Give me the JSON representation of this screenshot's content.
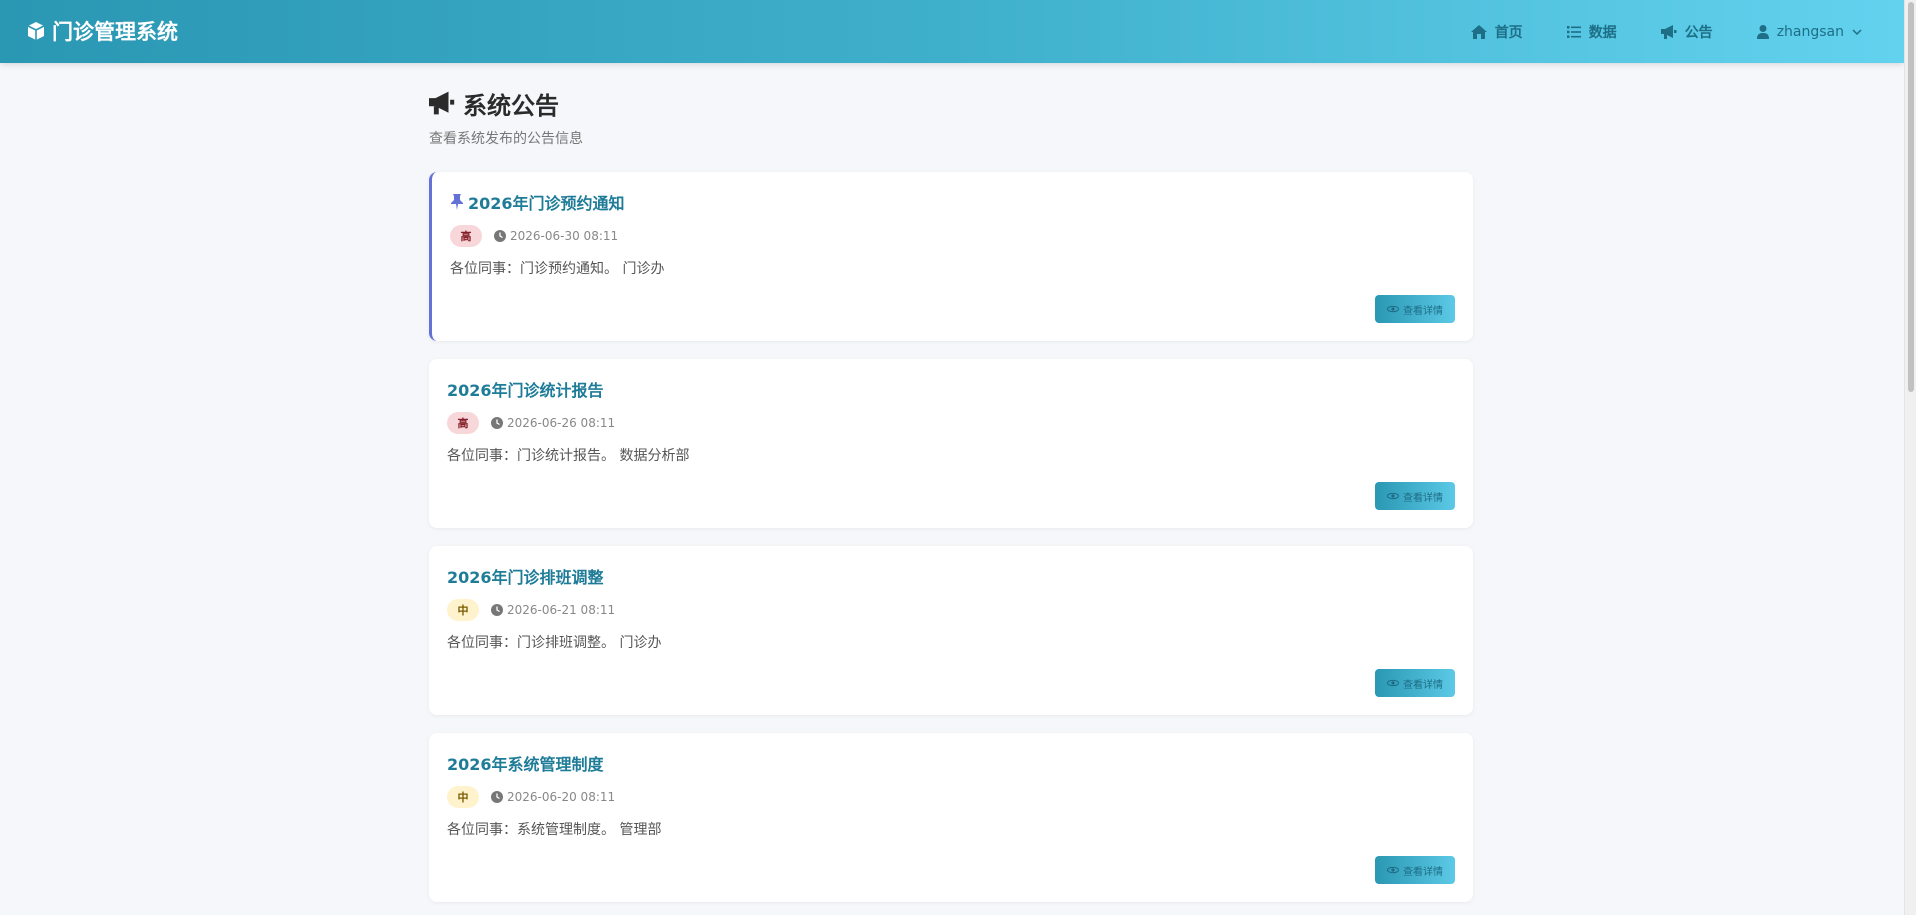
{
  "app": {
    "title": "门诊管理系统"
  },
  "nav": {
    "items": [
      {
        "label": "首页",
        "icon": "home-icon"
      },
      {
        "label": "数据",
        "icon": "list-icon"
      },
      {
        "label": "公告",
        "icon": "megaphone-icon"
      }
    ],
    "user": {
      "name": "zhangsan",
      "icon": "user-icon"
    }
  },
  "page": {
    "title": "系统公告",
    "subtitle": "查看系统发布的公告信息"
  },
  "announcements": [
    {
      "title": "2026年门诊预约通知",
      "pinned": true,
      "priority": "高",
      "priority_level": "high",
      "time": "2026-06-30 08:11",
      "content": "各位同事：门诊预约通知。 门诊办",
      "button": "查看详情"
    },
    {
      "title": "2026年门诊统计报告",
      "pinned": false,
      "priority": "高",
      "priority_level": "high",
      "time": "2026-06-26 08:11",
      "content": "各位同事：门诊统计报告。 数据分析部",
      "button": "查看详情"
    },
    {
      "title": "2026年门诊排班调整",
      "pinned": false,
      "priority": "中",
      "priority_level": "mid",
      "time": "2026-06-21 08:11",
      "content": "各位同事：门诊排班调整。 门诊办",
      "button": "查看详情"
    },
    {
      "title": "2026年系统管理制度",
      "pinned": false,
      "priority": "中",
      "priority_level": "mid",
      "time": "2026-06-20 08:11",
      "content": "各位同事：系统管理制度。 管理部",
      "button": "查看详情"
    }
  ],
  "colors": {
    "header_start": "#2a97b3",
    "header_end": "#62d2ef",
    "title_accent": "#1f7c98",
    "pinned_border": "#6472d8",
    "badge_high_bg": "#f8d7da",
    "badge_mid_bg": "#fff3cd"
  }
}
